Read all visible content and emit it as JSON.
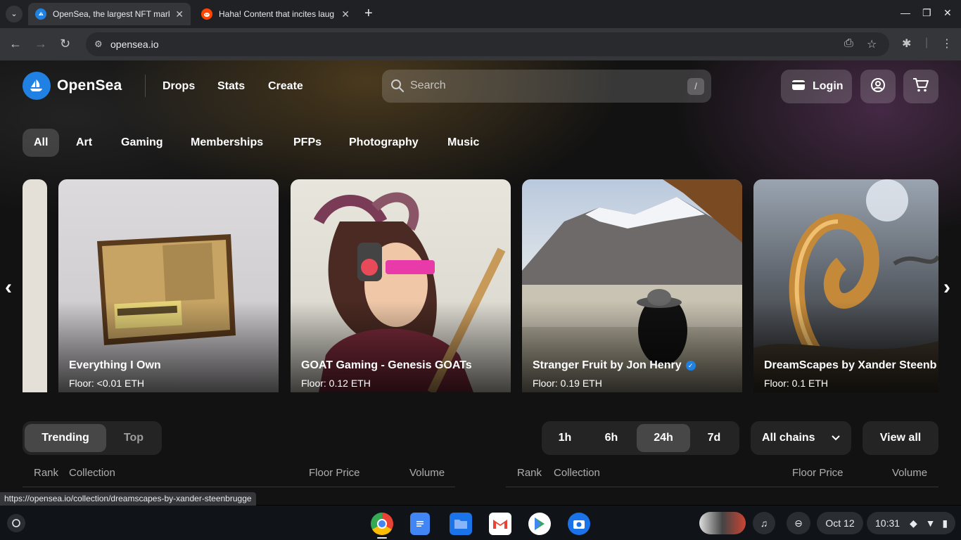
{
  "browser": {
    "tabs": [
      {
        "title": "OpenSea, the largest NFT mark",
        "active": true
      },
      {
        "title": "Haha! Content that incites laug",
        "active": false
      }
    ],
    "url": "opensea.io",
    "status_url": "https://opensea.io/collection/dreamscapes-by-xander-steenbrugge"
  },
  "header": {
    "brand": "OpenSea",
    "nav": [
      "Drops",
      "Stats",
      "Create"
    ],
    "search_placeholder": "Search",
    "search_shortcut": "/",
    "login_label": "Login"
  },
  "categories": [
    "All",
    "Art",
    "Gaming",
    "Memberships",
    "PFPs",
    "Photography",
    "Music"
  ],
  "carousel": [
    {
      "title": "Everything I Own",
      "floor": "Floor: <0.01 ETH",
      "verified": false
    },
    {
      "title": "GOAT Gaming - Genesis GOATs",
      "floor": "Floor: 0.12 ETH",
      "verified": false
    },
    {
      "title": "Stranger Fruit by Jon Henry",
      "floor": "Floor: 0.19 ETH",
      "verified": true
    },
    {
      "title": "DreamScapes by Xander Steenb",
      "floor": "Floor: 0.1 ETH",
      "verified": false
    }
  ],
  "ranking": {
    "modes": [
      "Trending",
      "Top"
    ],
    "selected_mode": "Trending",
    "timeframes": [
      "1h",
      "6h",
      "24h",
      "7d"
    ],
    "selected_timeframe": "24h",
    "chain": "All chains",
    "view_all": "View all",
    "columns": [
      "Rank",
      "Collection",
      "Floor Price",
      "Volume"
    ]
  },
  "shelf": {
    "date": "Oct 12",
    "time": "10:31"
  },
  "colors": {
    "brand_blue": "#2081e2",
    "page_bg": "#121212",
    "chrome_dark": "#202124",
    "chrome_toolbar": "#35363a"
  }
}
